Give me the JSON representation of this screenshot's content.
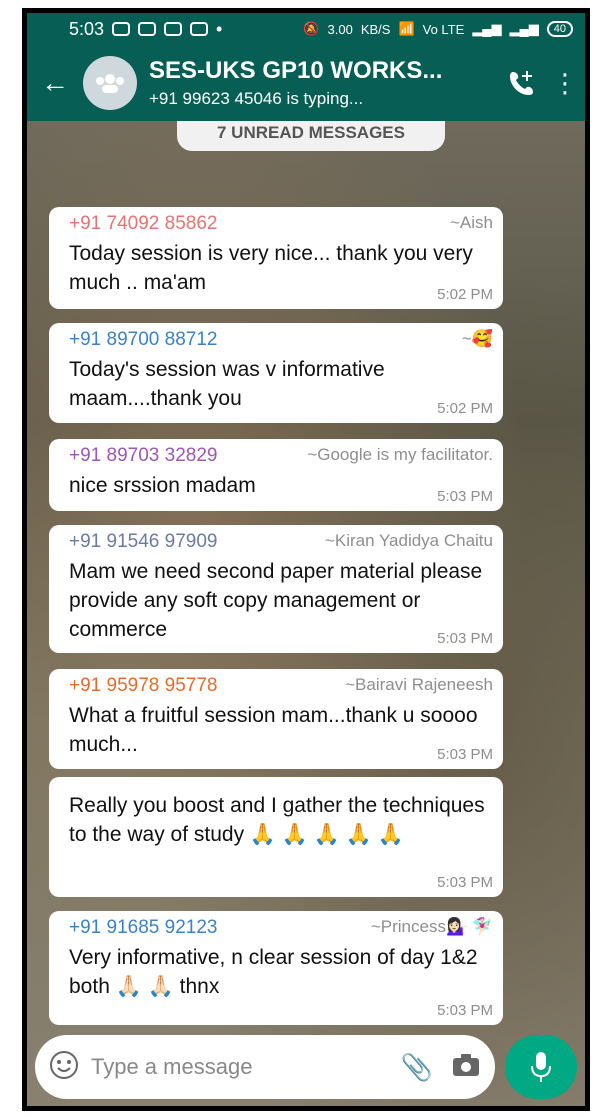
{
  "status": {
    "time": "5:03",
    "speed_value": "3.00",
    "speed_unit": "KB/S",
    "network": "Vo LTE",
    "battery": "40"
  },
  "header": {
    "title": "SES-UKS GP10 WORKS...",
    "subtitle": "+91 99623 45046 is typing..."
  },
  "chat": {
    "unread_banner": "7 UNREAD MESSAGES",
    "messages": [
      {
        "number": "+91 74092 85862",
        "nick": "~Aish",
        "text": "Today session is very nice... thank you very much .. ma'am",
        "time": "5:02 PM"
      },
      {
        "number": "+91 89700 88712",
        "nick": "~🥰",
        "text": "Today's session was v informative maam....thank you",
        "time": "5:02 PM"
      },
      {
        "number": "+91 89703 32829",
        "nick": "~Google is my facilitator.",
        "text": "nice srssion madam",
        "time": "5:03 PM"
      },
      {
        "number": "+91 91546 97909",
        "nick": "~Kiran Yadidya Chaitu",
        "text": "Mam we need second paper material please provide any soft copy management or commerce",
        "time": "5:03 PM"
      },
      {
        "number": "+91 95978 95778",
        "nick": "~Bairavi Rajeneesh",
        "text": "What a fruitful session mam...thank u soooo much...",
        "time": "5:03 PM"
      },
      {
        "text": "Really you boost and I gather the techniques to the way of study 🙏 🙏 🙏 🙏 🙏",
        "time": "5:03 PM"
      },
      {
        "number": "+91 91685 92123",
        "nick": "~Princess💁🏻‍♀️ 🧚🏻‍♀️",
        "text": "Very informative, n clear session of day 1&2 both 🙏🏻 🙏🏻 thnx",
        "time": "5:03 PM"
      }
    ]
  },
  "composer": {
    "placeholder": "Type a message"
  },
  "icons": {
    "back": "arrow-left-icon",
    "group": "group-avatar-icon",
    "call": "add-call-icon",
    "more": "more-vert-icon",
    "emoji": "emoji-icon",
    "attach": "attach-icon",
    "camera": "camera-icon",
    "mic": "mic-icon"
  },
  "colors": {
    "header": "#075e54",
    "mic_button": "#00a884",
    "sender_colors": [
      "#e57373",
      "#3b82c4",
      "#9c57b6",
      "#6b7aa1",
      "#e36c2d",
      "#111111",
      "#3b82c4"
    ]
  }
}
